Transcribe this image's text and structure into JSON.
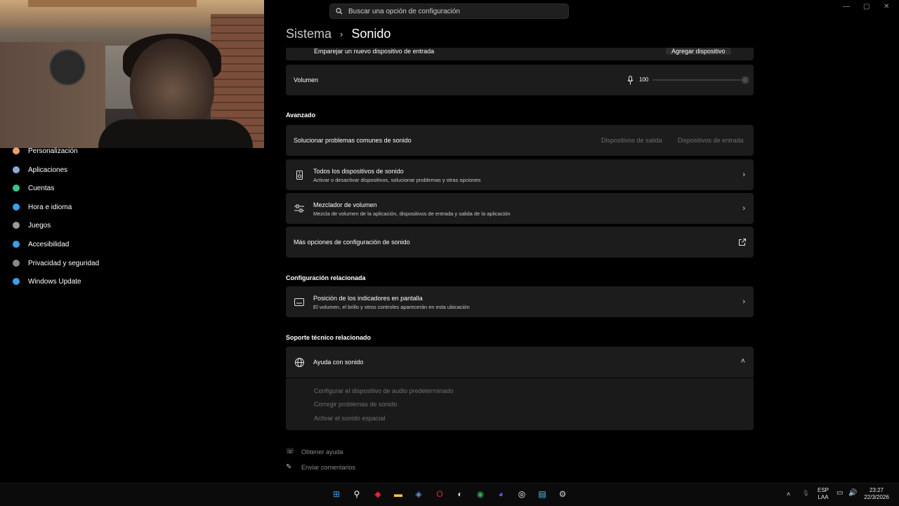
{
  "search": {
    "placeholder": "Buscar una opción de configuración"
  },
  "window_controls": [
    "—",
    "▢",
    "✕"
  ],
  "breadcrumb": {
    "parent": "Sistema",
    "separator": "›",
    "current": "Sonido"
  },
  "sidebar": {
    "items": [
      {
        "label": "Personalización",
        "icon": "brush-icon",
        "color": "#e8a26b"
      },
      {
        "label": "Aplicaciones",
        "icon": "apps-icon",
        "color": "#8fa8d8"
      },
      {
        "label": "Cuentas",
        "icon": "person-icon",
        "color": "#3bc48a"
      },
      {
        "label": "Hora e idioma",
        "icon": "globe-clock-icon",
        "color": "#3aa0e8"
      },
      {
        "label": "Juegos",
        "icon": "gamepad-icon",
        "color": "#9a9a9a"
      },
      {
        "label": "Accesibilidad",
        "icon": "accessibility-icon",
        "color": "#3aa0e8"
      },
      {
        "label": "Privacidad y seguridad",
        "icon": "shield-icon",
        "color": "#8a8a8a"
      },
      {
        "label": "Windows Update",
        "icon": "update-icon",
        "color": "#3aa0e8"
      }
    ]
  },
  "top_partial": {
    "label": "Emparejar un nuevo dispositivo de entrada",
    "button": "Agregar dispositivo"
  },
  "volume": {
    "label": "Volumen",
    "value": "100",
    "level": 1.0
  },
  "advanced": {
    "title": "Avanzado",
    "troubleshoot": {
      "label": "Solucionar problemas comunes de sonido",
      "btn_output": "Dispositivos de salida",
      "btn_input": "Dispositivos de entrada"
    },
    "all_devices": {
      "title": "Todos los dispositivos de sonido",
      "subtitle": "Activar o desactivar dispositivos, solucionar problemas y otras opciones"
    },
    "mixer": {
      "title": "Mezclador de volumen",
      "subtitle": "Mezcla de volumen de la aplicación, dispositivos de entrada y salida de la aplicación"
    },
    "more_options": {
      "label": "Más opciones de configuración de sonido"
    }
  },
  "related": {
    "title": "Configuración relacionada",
    "indicators": {
      "title": "Posición de los indicadores en pantalla",
      "subtitle": "El volumen, el brillo y otros controles aparecerán en esta ubicación"
    }
  },
  "support": {
    "title": "Soporte técnico relacionado",
    "help": {
      "label": "Ayuda con sonido"
    },
    "links": [
      "Configurar el dispositivo de audio predeterminado",
      "Corregir problemas de sonido",
      "Activar el sonido espacial"
    ]
  },
  "footer": {
    "get_help": "Obtener ayuda",
    "feedback": "Enviar comentarios"
  },
  "taskbar": {
    "apps": [
      {
        "name": "start-icon",
        "glyph": "⊞",
        "color": "#3aa0e8"
      },
      {
        "name": "search-icon",
        "glyph": "⚲",
        "color": "#ffffff"
      },
      {
        "name": "app-red-icon",
        "glyph": "◆",
        "color": "#e0243b"
      },
      {
        "name": "file-explorer-icon",
        "glyph": "▬",
        "color": "#f5c242"
      },
      {
        "name": "app-blue-icon",
        "glyph": "◈",
        "color": "#6f8fd8"
      },
      {
        "name": "opera-icon",
        "glyph": "O",
        "color": "#e0243b"
      },
      {
        "name": "steam-icon",
        "glyph": "◐",
        "color": "#cfd8e3"
      },
      {
        "name": "chrome-icon",
        "glyph": "◉",
        "color": "#34a853"
      },
      {
        "name": "discord-icon",
        "glyph": "◕",
        "color": "#5865f2"
      },
      {
        "name": "obs-icon",
        "glyph": "◎",
        "color": "#ffffff"
      },
      {
        "name": "notepad-icon",
        "glyph": "▤",
        "color": "#4fc3f7"
      },
      {
        "name": "settings-icon",
        "glyph": "⚙",
        "color": "#d0d0d0"
      }
    ],
    "lang_top": "ESP",
    "lang_bottom": "LAA",
    "time": "23:27",
    "date": "22/3/2026"
  }
}
